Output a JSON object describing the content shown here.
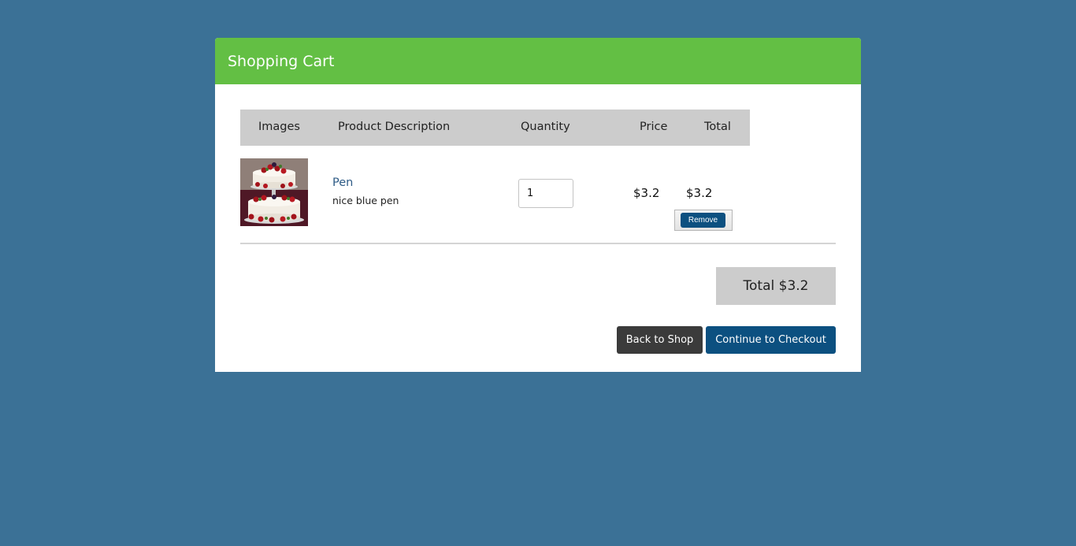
{
  "header": {
    "title": "Shopping Cart"
  },
  "table": {
    "columns": [
      "Images",
      "Product Description",
      "Quantity",
      "Price",
      "Total"
    ]
  },
  "items": [
    {
      "image_icon": "cake-photo",
      "name": "Pen",
      "description": "nice blue pen",
      "quantity": "1",
      "price": "$3.2",
      "total": "$3.2",
      "remove_label": "Remove"
    }
  ],
  "summary": {
    "total_label": "Total $3.2"
  },
  "actions": {
    "back_label": "Back to Shop",
    "checkout_label": "Continue to Checkout"
  },
  "colors": {
    "background": "#3b7196",
    "header": "#63bf44",
    "primary_button": "#0c5080",
    "secondary_button": "#3b3b3b",
    "table_header": "#cccccc"
  }
}
